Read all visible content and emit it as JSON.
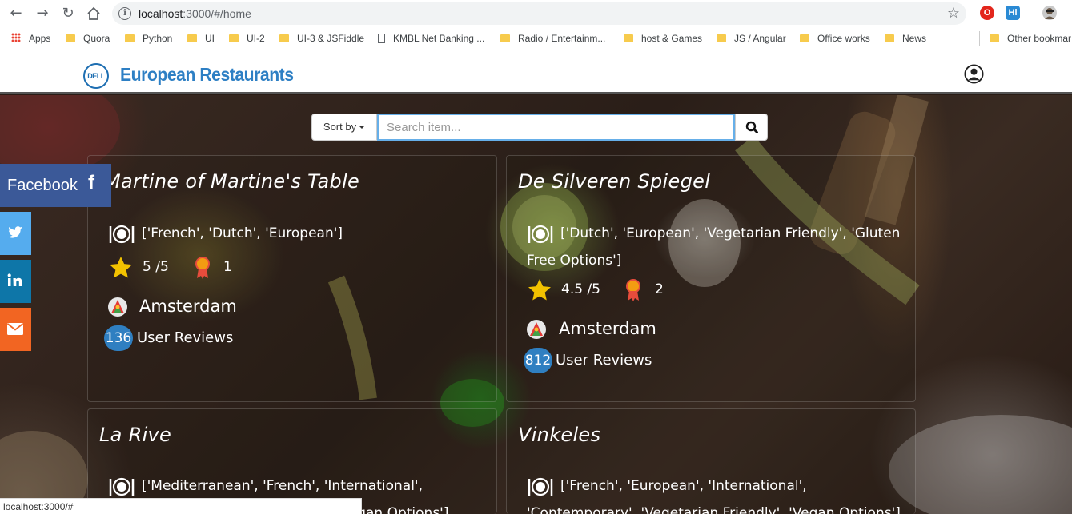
{
  "browser": {
    "url_host": "localhost",
    "url_path": ":3000/#/home",
    "status_url": "localhost:3000/#",
    "bookmarks": [
      {
        "label": "Apps",
        "kind": "apps"
      },
      {
        "label": "Quora",
        "kind": "folder"
      },
      {
        "label": "Python",
        "kind": "folder"
      },
      {
        "label": "UI",
        "kind": "folder"
      },
      {
        "label": "UI-2",
        "kind": "folder"
      },
      {
        "label": "UI-3 & JSFiddle",
        "kind": "folder"
      },
      {
        "label": "KMBL Net Banking ...",
        "kind": "doc"
      },
      {
        "label": "Radio / Entertainm...",
        "kind": "folder"
      },
      {
        "label": "host & Games",
        "kind": "folder"
      },
      {
        "label": "JS / Angular",
        "kind": "folder"
      },
      {
        "label": "Office works",
        "kind": "folder"
      },
      {
        "label": "News",
        "kind": "folder"
      },
      {
        "label": "Other bookmar",
        "kind": "folder"
      }
    ],
    "extensions": [
      {
        "name": "opera-extension-icon",
        "color": "#e3261c",
        "glyph": "O"
      },
      {
        "name": "hi-extension-icon",
        "color": "#2a8ad4",
        "glyph": "Hi"
      }
    ]
  },
  "header": {
    "logo_text": "DELL",
    "brand": "European Restaurants",
    "brand_color": "#2d7fc4"
  },
  "search": {
    "sort_label": "Sort by",
    "placeholder": "Search item..."
  },
  "social": {
    "facebook_label": "Facebook",
    "facebook_glyph": "f",
    "colors": {
      "facebook": "#3b5998",
      "twitter": "#55acee",
      "linkedin": "#0e76a8",
      "email": "#f26522"
    }
  },
  "restaurants": [
    {
      "name": "Martine of Martine's Table",
      "cuisines": "['French', 'Dutch', 'European']",
      "rating": "5 /5",
      "rank": "1",
      "city": "Amsterdam",
      "review_count": "136",
      "reviews_label": "User Reviews"
    },
    {
      "name": "De Silveren Spiegel",
      "cuisines": "['Dutch', 'European', 'Vegetarian Friendly', 'Gluten Free Options']",
      "rating": "4.5 /5",
      "rank": "2",
      "city": "Amsterdam",
      "review_count": "812",
      "reviews_label": "User Reviews"
    },
    {
      "name": "La Rive",
      "cuisines": "['Mediterranean', 'French', 'International', 'European', 'Vegetarian Friendly', 'Vegan Options']"
    },
    {
      "name": "Vinkeles",
      "cuisines": "['French', 'European', 'International', 'Contemporary', 'Vegetarian Friendly', 'Vegan Options']"
    }
  ]
}
